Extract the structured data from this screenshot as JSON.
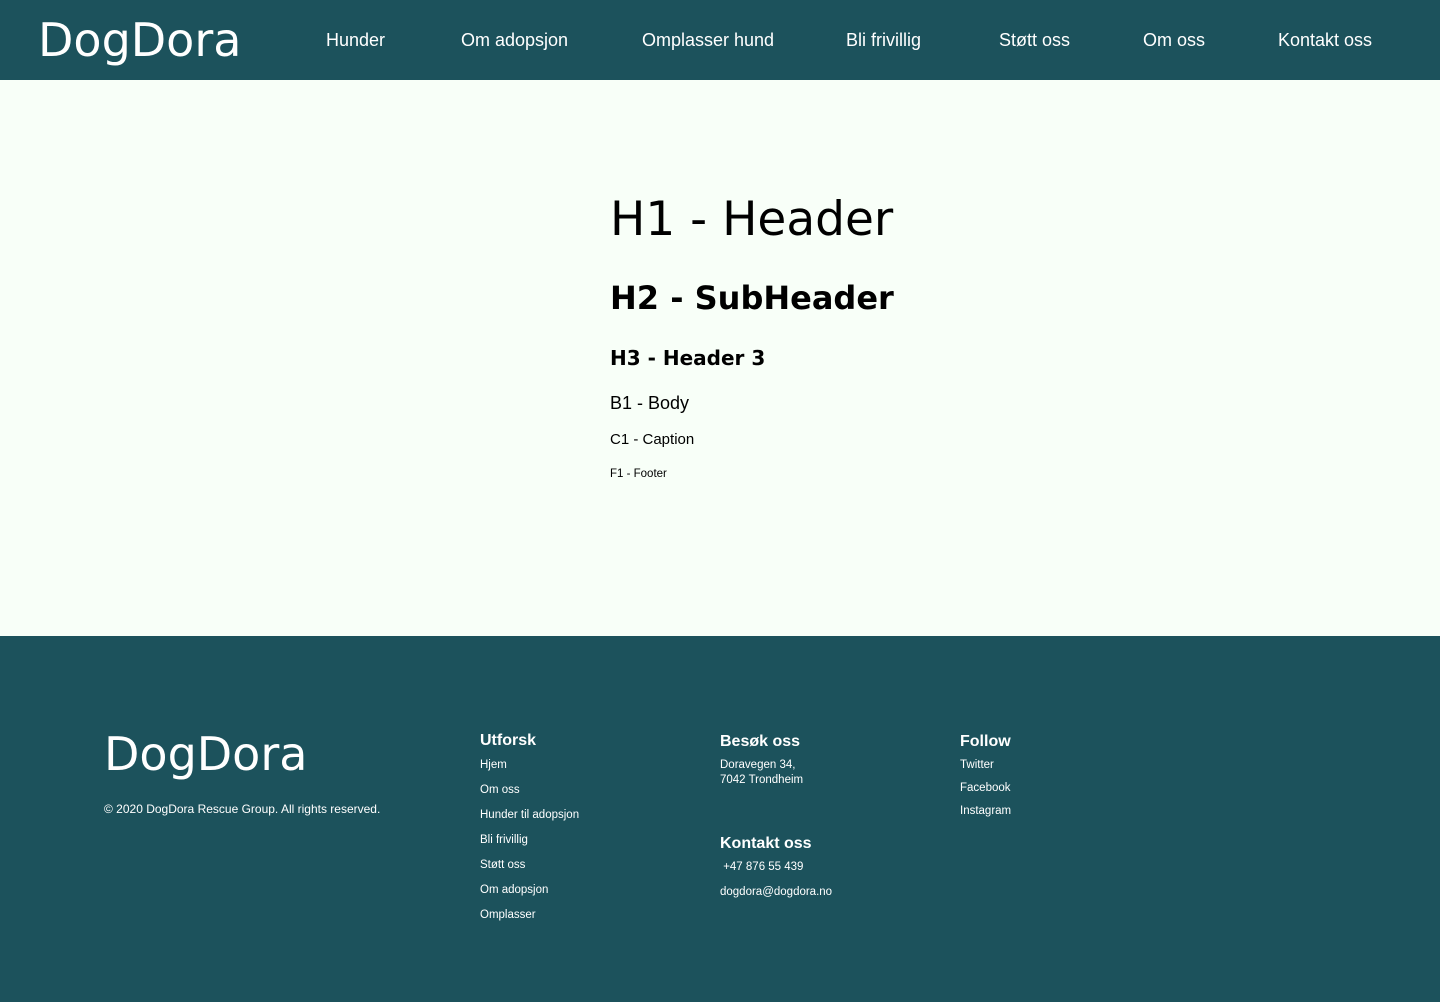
{
  "header": {
    "logo": "DogDora",
    "nav": [
      {
        "label": "Hunder"
      },
      {
        "label": "Om adopsjon"
      },
      {
        "label": "Omplasser hund"
      },
      {
        "label": "Bli frivillig"
      },
      {
        "label": "Støtt oss"
      },
      {
        "label": "Om oss"
      },
      {
        "label": "Kontakt oss"
      }
    ]
  },
  "typography": {
    "h1": "H1 - Header",
    "h2": "H2 - SubHeader",
    "h3": "H3 - Header 3",
    "b1": "B1 - Body",
    "c1": "C1 - Caption",
    "f1": "F1 - Footer"
  },
  "footer": {
    "logo": "DogDora",
    "copyright": "© 2020 DogDora Rescue Group. All rights reserved.",
    "explore": {
      "heading": "Utforsk",
      "links": [
        "Hjem",
        "Om oss",
        "Hunder til adopsjon",
        "Bli frivillig",
        "Støtt oss",
        "Om adopsjon",
        "Omplasser"
      ]
    },
    "visit": {
      "heading": "Besøk oss",
      "address_line1": "Doravegen 34,",
      "address_line2": "7042 Trondheim"
    },
    "contact": {
      "heading": "Kontakt oss",
      "phone": " +47 876 55 439",
      "email": "dogdora@dogdora.no"
    },
    "follow": {
      "heading": "Follow",
      "links": [
        "Twitter",
        "Facebook",
        "Instagram"
      ]
    }
  },
  "colors": {
    "brand_teal": "#1c525c",
    "page_background": "#f8fff8",
    "text_dark": "#000000",
    "text_light": "#ffffff"
  }
}
